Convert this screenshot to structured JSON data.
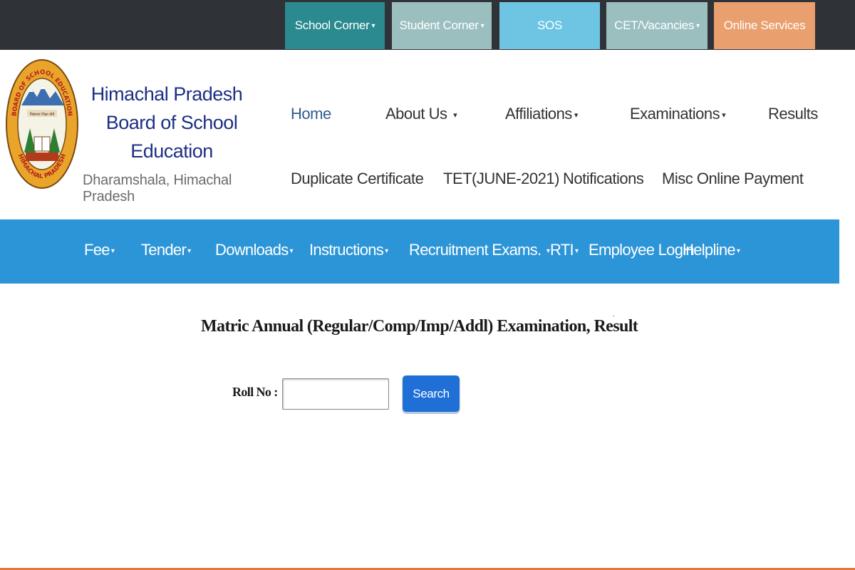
{
  "top_tabs": [
    {
      "label": "School Corner",
      "has_caret": true,
      "color": "#2a8a8f"
    },
    {
      "label": "Student Corner",
      "has_caret": true,
      "color": "#9bbfbf"
    },
    {
      "label": "SOS",
      "has_caret": false,
      "color": "#6ec5e3"
    },
    {
      "label": "CET/Vacancies",
      "has_caret": true,
      "color": "#9bbfbf"
    },
    {
      "label": "Online Services",
      "has_caret": false,
      "color": "#ea9f6e"
    }
  ],
  "caret_symbol": "▾",
  "logo": {
    "outer_text_top": "BOARD OF SCHOOL EDUCATION",
    "outer_text_bottom": "HIMACHAL PRADESH",
    "inner_text": "विद्यालय शिक्षा बोर्ड"
  },
  "brand": {
    "line1": "Himachal Pradesh",
    "line2": "Board of School Education",
    "line3": "Dharamshala, Himachal Pradesh"
  },
  "main_nav": {
    "home": "Home",
    "about_us": "About Us",
    "affiliations": "Affiliations",
    "examinations": "Examinations",
    "results": "Results",
    "duplicate_certificate": "Duplicate Certificate",
    "tet": "TET(JUNE-2021)",
    "notifications": "Notifications",
    "misc_payment": "Misc Online Payment"
  },
  "blue_menu": {
    "fee": "Fee",
    "tender": "Tender",
    "downloads": "Downloads",
    "instructions": "Instructions",
    "recruitment": "Recruitment Exams.",
    "rti": "RTI",
    "employee_login": "Employee Login",
    "helpline": "Helpline"
  },
  "result_page": {
    "title": "Matric Annual (Regular/Comp/Imp/Addl) Examination, Result",
    "roll_label": "Roll No :",
    "roll_value": "",
    "search_label": "Search"
  },
  "colors": {
    "topbar_bg": "#2f3237",
    "blue_menu_bg": "#2c95d8",
    "brand_text": "#1d2f84",
    "search_button": "#1f6fd6",
    "footer_line": "#e07a3c"
  }
}
